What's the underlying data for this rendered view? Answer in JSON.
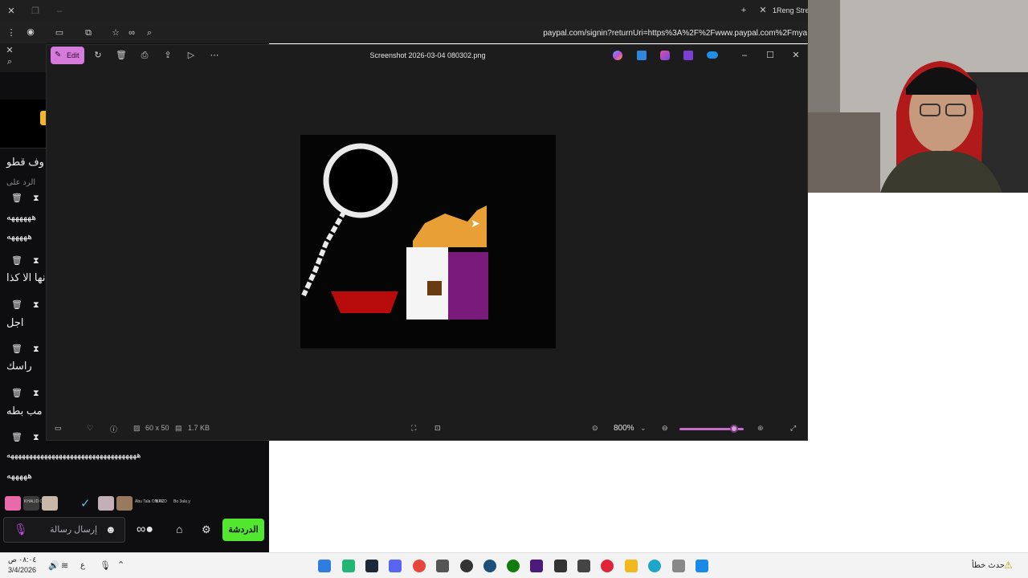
{
  "browser": {
    "address": "paypal.com/signin?returnUri=https%3A%2F%2Fwww.paypal.com%2Fmya",
    "tab_title": "1Reng Strea"
  },
  "viewer": {
    "title": "Screenshot 2026-03-04 080302.png",
    "edit_label": "Edit",
    "dimensions": "60 x 50",
    "file_size": "1.7 KB",
    "zoom": "800%",
    "zoom_level": 0.85
  },
  "chat": {
    "messages": [
      {
        "text": "وف قطو"
      },
      {
        "text": "الرد على"
      },
      {
        "text": "ههههههه"
      },
      {
        "text": "هههههه"
      },
      {
        "text": "نها الا كذا"
      },
      {
        "text": "اجل"
      },
      {
        "text": "راسك"
      },
      {
        "text": "مب بطه"
      },
      {
        "text": "هههههههههههههههههههههههههههههههههههه"
      },
      {
        "text": "هههههه"
      }
    ],
    "input_placeholder": "إرسال رسالة",
    "send_label": "الدردشة",
    "emote_labels": [
      "KHALID ON TOP",
      "Abu Tala ON TV",
      "BACD",
      "Bo 3ala y"
    ]
  },
  "taskbar": {
    "time": "٠٨:٠٤ ص",
    "date": "3/4/2026",
    "lang": "ع",
    "status_text": "حدث خطأ"
  },
  "colors": {
    "accent_pink": "#d57bdc",
    "send_green": "#52e62e",
    "chat_bg": "#0e0e10",
    "viewer_bg": "#1c1c1c"
  }
}
